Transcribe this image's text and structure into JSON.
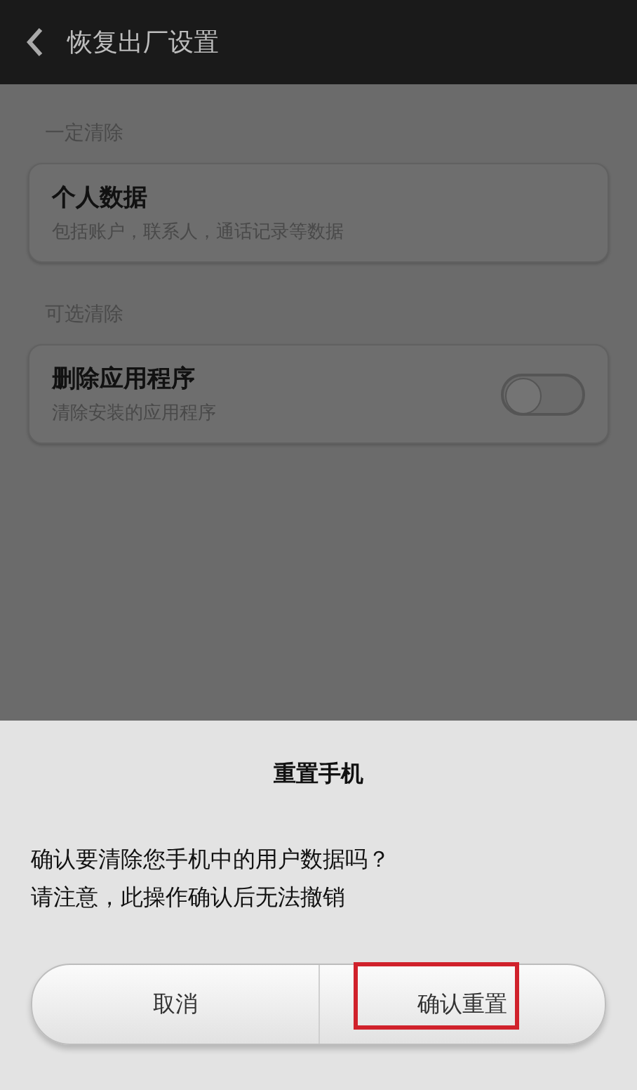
{
  "header": {
    "title": "恢复出厂设置"
  },
  "sections": [
    {
      "heading": "一定清除",
      "items": [
        {
          "kind": "plain",
          "title": "个人数据",
          "subtitle": "包括账户，联系人，通话记录等数据"
        }
      ]
    },
    {
      "heading": "可选清除",
      "items": [
        {
          "kind": "toggle",
          "title": "删除应用程序",
          "subtitle": "清除安装的应用程序",
          "on": false
        }
      ]
    }
  ],
  "dialog": {
    "title": "重置手机",
    "message": [
      "确认要清除您手机中的用户数据吗？",
      "请注意，此操作确认后无法撤销"
    ],
    "buttons": [
      {
        "label": "取消",
        "highlighted": false
      },
      {
        "label": "确认重置",
        "highlighted": true
      }
    ]
  }
}
